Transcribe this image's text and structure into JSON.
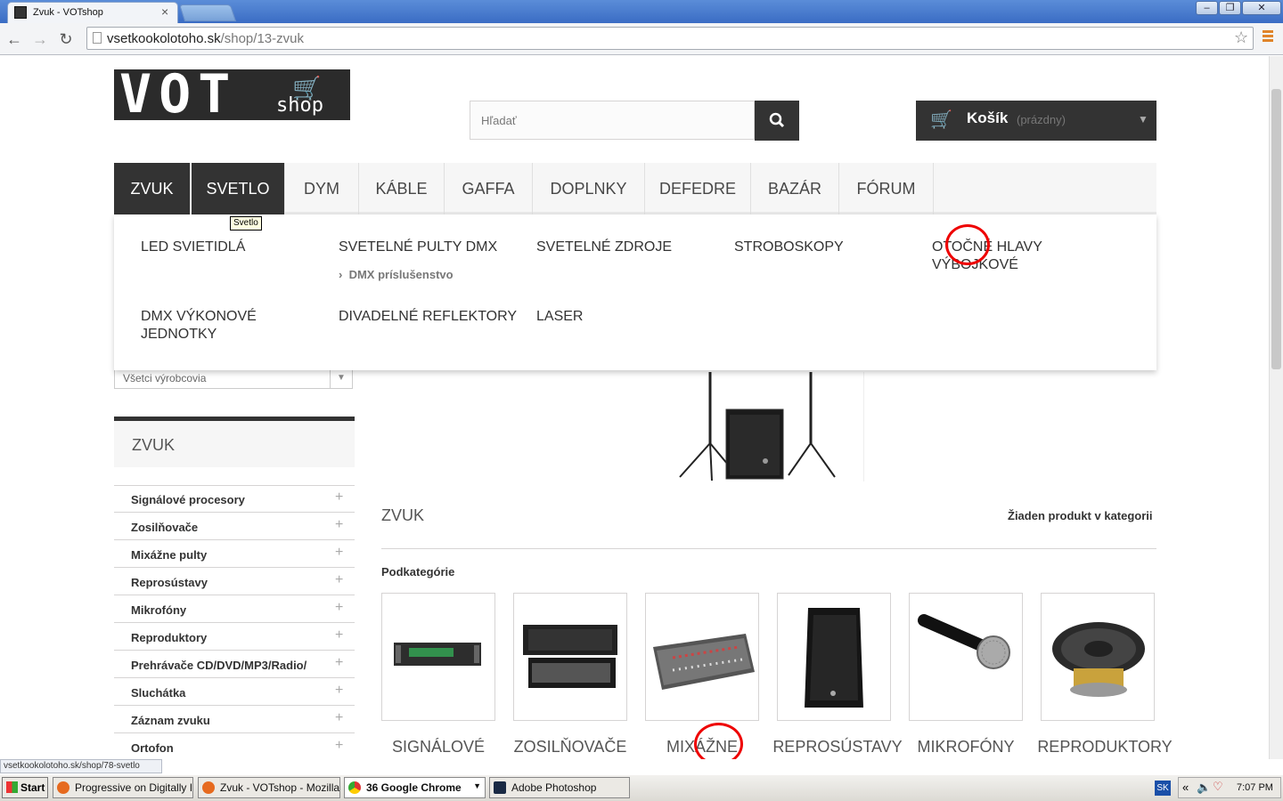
{
  "browser": {
    "tab_title": "Zvuk - VOTshop",
    "tab_close": "×",
    "url_host": "vsetkookolotoho.sk",
    "url_path": "/shop/13-zvuk",
    "window_min": "–",
    "window_max": "❐",
    "window_close": "✕"
  },
  "header": {
    "logo_text": "VOT",
    "logo_sub": "shop",
    "search_placeholder": "Hľadať",
    "cart_label": "Košík",
    "cart_status": "(prázdny)"
  },
  "menu": {
    "items": [
      "ZVUK",
      "SVETLO",
      "DYM",
      "KÁBLE",
      "GAFFA",
      "DOPLNKY",
      "DEFEDRE",
      "BAZÁR",
      "FÓRUM"
    ],
    "tooltip": "Svetlo"
  },
  "dropdown": {
    "items": [
      "LED svietidlá",
      "Svetelné pulty DMX",
      "Svetelné zdroje",
      "Stroboskopy",
      "Otočné hlavy výbojkové",
      "DMX výkonové jednotky",
      "Divadelné reflektory",
      "Laser"
    ],
    "sub_item": "DMX príslušenstvo"
  },
  "sidebar": {
    "manufacturer_select": "Všetci výrobcovia",
    "title": "ZVUK",
    "items": [
      "Signálové procesory",
      "Zosilňovače",
      "Mixážne pulty",
      "Reprosústavy",
      "Mikrofóny",
      "Reproduktory",
      "Prehrávače CD/DVD/MP3/Radio/",
      "Sluchátka",
      "Záznam zvuku",
      "Ortofon"
    ]
  },
  "main": {
    "title": "ZVUK",
    "no_product": "Žiaden produkt v kategorii",
    "subcategories_title": "Podkategórie",
    "subcategories": [
      "SIGNÁLOVÉ CESORY",
      "ZOSILŇOVAČE",
      "MIXÁŽNE PULTY",
      "REPROSÚSTAVY",
      "MIKROFÓNY",
      "REPRODUKTORY"
    ]
  },
  "status_bar": "vsetkookolotoho.sk/shop/78-svetlo",
  "taskbar": {
    "start": "Start",
    "tasks": [
      "Progressive on Digitally I...",
      "Zvuk - VOTshop - Mozilla ...",
      "36 Google Chrome",
      "Adobe Photoshop"
    ],
    "lang": "SK",
    "clock": "7:07 PM"
  },
  "colors": {
    "dark": "#333333",
    "titlebar": "#3a6cc4",
    "annotation": "#e00000",
    "accent_menu_icon": "#e0842a"
  }
}
